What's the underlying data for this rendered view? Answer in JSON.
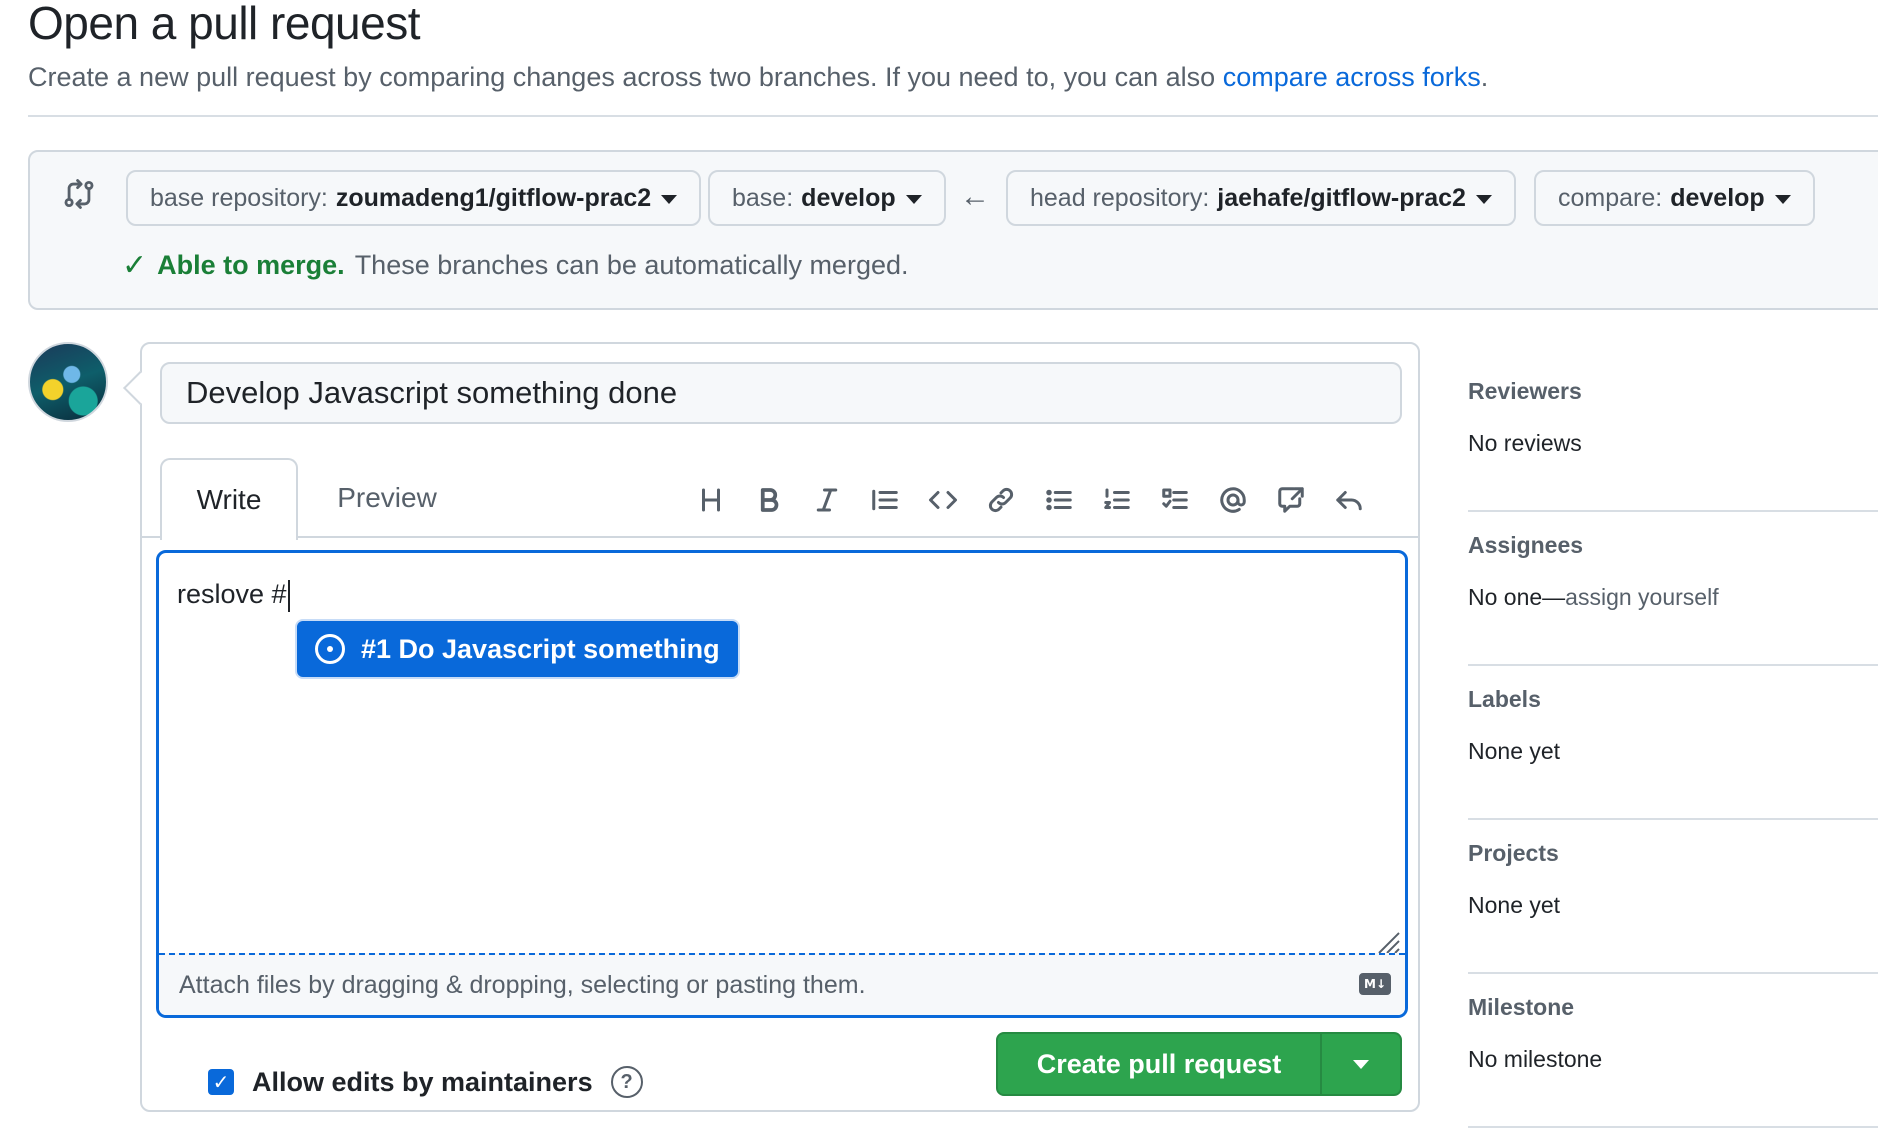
{
  "header": {
    "title": "Open a pull request",
    "subtitle": "Create a new pull request by comparing changes across two branches. If you need to, you can also",
    "compare_link": "compare across forks",
    "subtitle_end": "."
  },
  "compare": {
    "base_repo_label": "base repository:",
    "base_repo_value": "zoumadeng1/gitflow-prac2",
    "base_label": "base:",
    "base_value": "develop",
    "arrow": "←",
    "head_repo_label": "head repository:",
    "head_repo_value": "jaehafe/gitflow-prac2",
    "compare_label": "compare:",
    "compare_value": "develop",
    "merge_status": "Able to merge.",
    "merge_detail": "These branches can be automatically merged."
  },
  "form": {
    "title_value": "Develop Javascript something done",
    "tab_write": "Write",
    "tab_preview": "Preview",
    "toolbar_icons": [
      "heading-icon",
      "bold-icon",
      "italic-icon",
      "quote-icon",
      "code-icon",
      "link-icon",
      "bulleted-list-icon",
      "numbered-list-icon",
      "task-list-icon",
      "mention-icon",
      "reference-icon",
      "reply-icon"
    ],
    "body_text": "reslove #",
    "suggestion": "#1 Do Javascript something",
    "attach_text": "Attach files by dragging & dropping, selecting or pasting them.",
    "allow_edits_label": "Allow edits by maintainers",
    "allow_edits_checked": true,
    "create_button": "Create pull request"
  },
  "sidebar": {
    "sections": [
      {
        "heading": "Reviewers",
        "value": "No reviews"
      },
      {
        "heading": "Assignees",
        "value": "No one—",
        "link": "assign yourself"
      },
      {
        "heading": "Labels",
        "value": "None yet"
      },
      {
        "heading": "Projects",
        "value": "None yet"
      },
      {
        "heading": "Milestone",
        "value": "No milestone"
      }
    ]
  },
  "colors": {
    "accent": "#0969da",
    "success": "#1a7f37",
    "button_green": "#2da44e",
    "border": "#d0d7de"
  }
}
